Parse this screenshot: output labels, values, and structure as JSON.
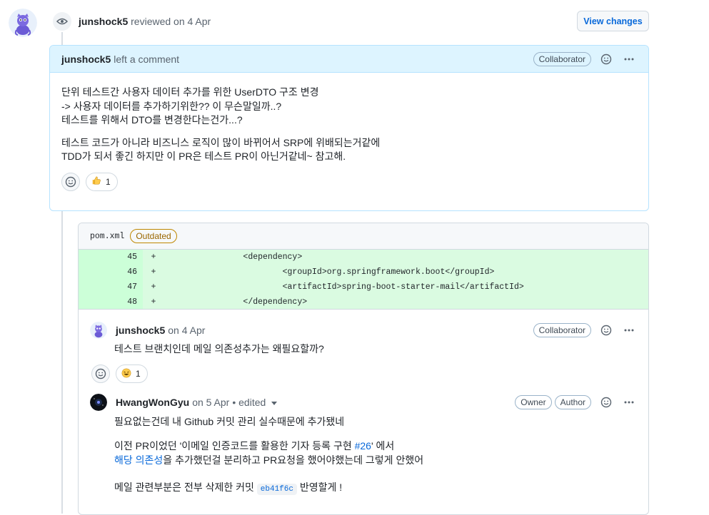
{
  "review": {
    "user": "junshock5",
    "action": "reviewed on 4 Apr",
    "view_changes_label": "View changes"
  },
  "comment": {
    "user": "junshock5",
    "action": "left a comment",
    "badge": "Collaborator",
    "lines": [
      "단위 테스트간 사용자 데이터 추가를 위한 UserDTO 구조 변경",
      "-> 사용자 데이터를 추가하기위한?? 이 무슨말일까..?",
      "테스트를 위해서 DTO를 변경한다는건가...?"
    ],
    "lines2": [
      "테스트 코드가 아니라 비즈니스 로직이 많이 바뀌어서 SRP에 위배되는거같에",
      "TDD가 되서 좋긴 하지만 이 PR은 테스트 PR이 아닌거같네~ 참고해."
    ],
    "reaction_count": "1"
  },
  "diff": {
    "file": "pom.xml",
    "status": "Outdated",
    "rows": [
      {
        "num": "45",
        "sign": "+",
        "code": "                <dependency>"
      },
      {
        "num": "46",
        "sign": "+",
        "code": "                        <groupId>org.springframework.boot</groupId>"
      },
      {
        "num": "47",
        "sign": "+",
        "code": "                        <artifactId>spring-boot-starter-mail</artifactId>"
      },
      {
        "num": "48",
        "sign": "+",
        "code": "                </dependency>"
      }
    ]
  },
  "reply1": {
    "user": "junshock5",
    "time": "on 4 Apr",
    "badge": "Collaborator",
    "text": "테스트 브랜치인데 메일 의존성추가는 왜필요할까?",
    "reaction_count": "1"
  },
  "reply2": {
    "user": "HwangWonGyu",
    "time": "on 5 Apr",
    "edited": "• edited",
    "badge_owner": "Owner",
    "badge_author": "Author",
    "p1": "필요없는건데 내 Github 커밋 관리 실수때문에 추가됐네",
    "p2a": "이전 PR이었던 '이메일 인증코드를 활용한 기자 등록 구현 ",
    "p2_link": "#26",
    "p2b": "' 에서",
    "p3_link": "해당 의존성",
    "p3b": "을 추가했던걸 분리하고 PR요청을 했어야했는데 그렇게 안했어",
    "p4a": "메일 관련부분은 전부 삭제한 커밋 ",
    "p4_sha": "eb41f6c",
    "p4b": " 반영할게 !"
  }
}
